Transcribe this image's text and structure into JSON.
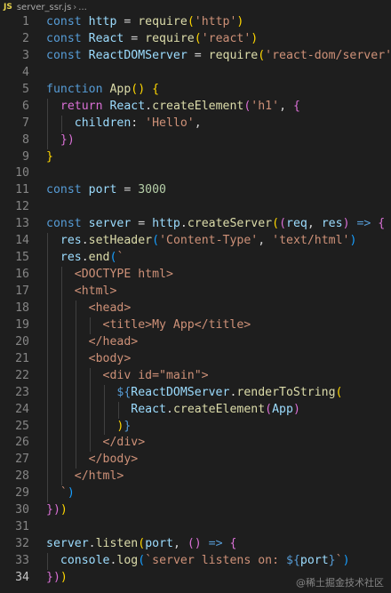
{
  "breadcrumb": {
    "badge": "JS",
    "filename": "server_ssr.js",
    "separator": "›",
    "ellipsis": "..."
  },
  "editor": {
    "current_line": 34,
    "lines": [
      [
        [
          "const ",
          "k"
        ],
        [
          "http",
          "v"
        ],
        [
          " = ",
          "p"
        ],
        [
          "require",
          "f"
        ],
        [
          "(",
          "y"
        ],
        [
          "'http'",
          "s"
        ],
        [
          ")",
          "y"
        ]
      ],
      [
        [
          "const ",
          "k"
        ],
        [
          "React",
          "v"
        ],
        [
          " = ",
          "p"
        ],
        [
          "require",
          "f"
        ],
        [
          "(",
          "y"
        ],
        [
          "'react'",
          "s"
        ],
        [
          ")",
          "y"
        ]
      ],
      [
        [
          "const ",
          "k"
        ],
        [
          "ReactDOMServer",
          "v"
        ],
        [
          " = ",
          "p"
        ],
        [
          "require",
          "f"
        ],
        [
          "(",
          "y"
        ],
        [
          "'react-dom/server'",
          "s"
        ],
        [
          ")",
          "y"
        ]
      ],
      [],
      [
        [
          "function ",
          "k"
        ],
        [
          "App",
          "f"
        ],
        [
          "() ",
          "y"
        ],
        [
          "{",
          "y"
        ]
      ],
      [
        [
          "  return ",
          "m"
        ],
        [
          "React",
          "v"
        ],
        [
          ".",
          "p"
        ],
        [
          "createElement",
          "f"
        ],
        [
          "(",
          "m"
        ],
        [
          "'h1'",
          "s"
        ],
        [
          ", ",
          "p"
        ],
        [
          "{",
          "m"
        ]
      ],
      [
        [
          "    children",
          "v"
        ],
        [
          ": ",
          "p"
        ],
        [
          "'Hello'",
          "s"
        ],
        [
          ",",
          "p"
        ]
      ],
      [
        [
          "  })",
          "m"
        ]
      ],
      [
        [
          "}",
          "y"
        ]
      ],
      [],
      [
        [
          "const ",
          "k"
        ],
        [
          "port",
          "v"
        ],
        [
          " = ",
          "p"
        ],
        [
          "3000",
          "n"
        ]
      ],
      [],
      [
        [
          "const ",
          "k"
        ],
        [
          "server",
          "v"
        ],
        [
          " = ",
          "p"
        ],
        [
          "http",
          "v"
        ],
        [
          ".",
          "p"
        ],
        [
          "createServer",
          "f"
        ],
        [
          "(",
          "y"
        ],
        [
          "(",
          "m"
        ],
        [
          "req",
          "v"
        ],
        [
          ", ",
          "p"
        ],
        [
          "res",
          "v"
        ],
        [
          ") ",
          "m"
        ],
        [
          "=> ",
          "k"
        ],
        [
          "{",
          "m"
        ]
      ],
      [
        [
          "  res",
          "v"
        ],
        [
          ".",
          "p"
        ],
        [
          "setHeader",
          "f"
        ],
        [
          "(",
          "b"
        ],
        [
          "'Content-Type'",
          "s"
        ],
        [
          ", ",
          "p"
        ],
        [
          "'text/html'",
          "s"
        ],
        [
          ")",
          "b"
        ]
      ],
      [
        [
          "  res",
          "v"
        ],
        [
          ".",
          "p"
        ],
        [
          "end",
          "f"
        ],
        [
          "(",
          "b"
        ],
        [
          "`",
          "s"
        ]
      ],
      [
        [
          "    <DOCTYPE html>",
          "s"
        ]
      ],
      [
        [
          "    <html>",
          "s"
        ]
      ],
      [
        [
          "      <head>",
          "s"
        ]
      ],
      [
        [
          "        <title>My App</title>",
          "s"
        ]
      ],
      [
        [
          "      </head>",
          "s"
        ]
      ],
      [
        [
          "      <body>",
          "s"
        ]
      ],
      [
        [
          "        <div id=\"main\">",
          "s"
        ]
      ],
      [
        [
          "          ${",
          "k"
        ],
        [
          "ReactDOMServer",
          "v"
        ],
        [
          ".",
          "p"
        ],
        [
          "renderToString",
          "f"
        ],
        [
          "(",
          "y"
        ]
      ],
      [
        [
          "            React",
          "v"
        ],
        [
          ".",
          "p"
        ],
        [
          "createElement",
          "f"
        ],
        [
          "(",
          "m"
        ],
        [
          "App",
          "v"
        ],
        [
          ")",
          "m"
        ]
      ],
      [
        [
          "          )",
          "y"
        ],
        [
          "}",
          "k"
        ]
      ],
      [
        [
          "        </div>",
          "s"
        ]
      ],
      [
        [
          "      </body>",
          "s"
        ]
      ],
      [
        [
          "    </html>",
          "s"
        ]
      ],
      [
        [
          "  `",
          "s"
        ],
        [
          ")",
          "b"
        ]
      ],
      [
        [
          "})",
          "m"
        ],
        [
          ")",
          "y"
        ]
      ],
      [],
      [
        [
          "server",
          "v"
        ],
        [
          ".",
          "p"
        ],
        [
          "listen",
          "f"
        ],
        [
          "(",
          "y"
        ],
        [
          "port",
          "v"
        ],
        [
          ", ",
          "p"
        ],
        [
          "() ",
          "m"
        ],
        [
          "=> ",
          "k"
        ],
        [
          "{",
          "m"
        ]
      ],
      [
        [
          "  console",
          "v"
        ],
        [
          ".",
          "p"
        ],
        [
          "log",
          "f"
        ],
        [
          "(",
          "b"
        ],
        [
          "`server listens on: ",
          "s"
        ],
        [
          "${",
          "k"
        ],
        [
          "port",
          "v"
        ],
        [
          "}",
          "k"
        ],
        [
          "`",
          "s"
        ],
        [
          ")",
          "b"
        ]
      ],
      [
        [
          "})",
          "m"
        ],
        [
          ")",
          "y"
        ]
      ]
    ],
    "guides": [
      [],
      [],
      [],
      [],
      [],
      [
        0
      ],
      [
        0,
        1
      ],
      [
        0
      ],
      [],
      [],
      [],
      [],
      [],
      [
        0
      ],
      [
        0
      ],
      [
        0,
        1
      ],
      [
        0,
        1
      ],
      [
        0,
        1,
        2
      ],
      [
        0,
        1,
        2,
        3
      ],
      [
        0,
        1,
        2
      ],
      [
        0,
        1,
        2
      ],
      [
        0,
        1,
        2,
        3
      ],
      [
        0,
        1,
        2,
        3,
        4
      ],
      [
        0,
        1,
        2,
        3,
        4,
        5
      ],
      [
        0,
        1,
        2,
        3,
        4
      ],
      [
        0,
        1,
        2,
        3
      ],
      [
        0,
        1,
        2
      ],
      [
        0,
        1
      ],
      [
        0
      ],
      [],
      [],
      [],
      [
        0
      ],
      []
    ]
  },
  "watermark": "@稀土掘金技术社区"
}
